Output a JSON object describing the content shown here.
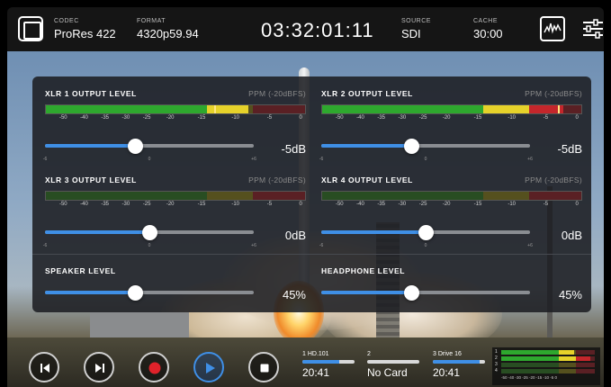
{
  "topbar": {
    "codec": {
      "label": "CODEC",
      "value": "ProRes 422"
    },
    "format": {
      "label": "FORMAT",
      "value": "4320p59.94"
    },
    "timecode": "03:32:01:11",
    "source": {
      "label": "SOURCE",
      "value": "SDI"
    },
    "cache": {
      "label": "CACHE",
      "value": "30:00"
    }
  },
  "colors": {
    "accent": "#3f8fe6",
    "meter_green": "#2ea82e",
    "meter_yellow": "#e6d22a",
    "meter_red": "#c4262b",
    "meter_green_dim": "#284d22",
    "meter_yellow_dim": "#55501e",
    "meter_red_dim": "#5a2024"
  },
  "meter_scale": [
    "-50",
    "-40",
    "-35",
    "-30",
    "-25",
    "-20",
    "-15",
    "-10",
    "-5",
    "0"
  ],
  "slider_scale": [
    "-6",
    "0",
    "+6"
  ],
  "audio": {
    "xlr1": {
      "title": "XLR 1 OUTPUT LEVEL",
      "ppm": "PPM (-20dBFS)",
      "meter_level": 0.78,
      "meter_peak": 0.65,
      "slider": 0.43,
      "value": "-5dB"
    },
    "xlr2": {
      "title": "XLR 2 OUTPUT LEVEL",
      "ppm": "PPM (-20dBFS)",
      "meter_level": 0.93,
      "meter_peak": 0.91,
      "slider": 0.43,
      "value": "-5dB"
    },
    "xlr3": {
      "title": "XLR 3 OUTPUT LEVEL",
      "ppm": "PPM (-20dBFS)",
      "meter_level": 0.0,
      "meter_peak": null,
      "slider": 0.5,
      "value": "0dB"
    },
    "xlr4": {
      "title": "XLR 4 OUTPUT LEVEL",
      "ppm": "PPM (-20dBFS)",
      "meter_level": 0.0,
      "meter_peak": null,
      "slider": 0.5,
      "value": "0dB"
    },
    "speaker": {
      "title": "SPEAKER LEVEL",
      "slider": 0.43,
      "value": "45%"
    },
    "headphone": {
      "title": "HEADPHONE LEVEL",
      "slider": 0.43,
      "value": "45%"
    }
  },
  "transport": {
    "buttons": [
      "skip-back",
      "skip-forward",
      "record",
      "play",
      "stop"
    ]
  },
  "slots": [
    {
      "name": "1  HD.101",
      "fill": 0.7,
      "time": "20:41"
    },
    {
      "name": "2",
      "fill": 0.0,
      "time": "No Card"
    },
    {
      "name": "3  Drive 16",
      "fill": 0.9,
      "time": "20:41"
    }
  ],
  "mini_meter": {
    "channels": [
      "1",
      "2",
      "3",
      "4"
    ],
    "scale": "-50 -40  -30 -25 -20  -15  -10  -5   0"
  }
}
